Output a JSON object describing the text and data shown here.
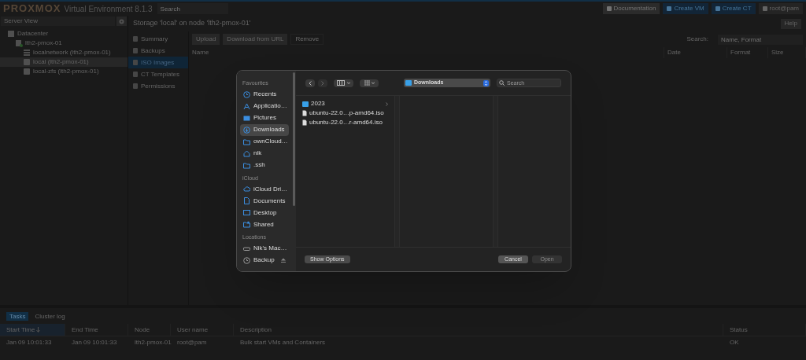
{
  "topbar": {
    "logo": "PROXMOX",
    "product": "Virtual Environment 8.1.3",
    "search_placeholder": "Search",
    "buttons": [
      {
        "label": "Documentation",
        "kind": "plain"
      },
      {
        "label": "Create VM",
        "kind": "primary"
      },
      {
        "label": "Create CT",
        "kind": "primary"
      },
      {
        "label": "root@pam",
        "kind": "user"
      }
    ]
  },
  "sidebar": {
    "view": "Server View",
    "tree": [
      {
        "label": "Datacenter",
        "kind": "datacenter",
        "selected": false,
        "children": [
          {
            "label": "lth2-pmox-01",
            "kind": "node",
            "selected": false,
            "children": [
              {
                "label": "localnetwork (lth2-pmox-01)",
                "kind": "network",
                "selected": false
              },
              {
                "label": "local (lth2-pmox-01)",
                "kind": "storage",
                "selected": true
              },
              {
                "label": "local-zfs (lth2-pmox-01)",
                "kind": "storage",
                "selected": false
              }
            ]
          }
        ]
      }
    ]
  },
  "content": {
    "title": "Storage 'local' on node 'lth2-pmox-01'",
    "help": "Help",
    "nav": [
      {
        "label": "Summary",
        "selected": false
      },
      {
        "label": "Backups",
        "selected": false
      },
      {
        "label": "ISO Images",
        "selected": true
      },
      {
        "label": "CT Templates",
        "selected": false
      },
      {
        "label": "Permissions",
        "selected": false
      }
    ],
    "toolbar": [
      {
        "label": "Upload",
        "disabled": false
      },
      {
        "label": "Download from URL",
        "disabled": false
      },
      {
        "label": "Remove",
        "disabled": true
      }
    ],
    "search_label": "Search:",
    "search_placeholder": "Name, Format",
    "columns": [
      "Name",
      "Date",
      "Format",
      "Size"
    ]
  },
  "tasks": {
    "tabs": [
      {
        "label": "Tasks",
        "selected": true
      },
      {
        "label": "Cluster log",
        "selected": false
      }
    ],
    "columns": [
      {
        "label": "Start Time",
        "sorted": true
      },
      {
        "label": "End Time",
        "sorted": false
      },
      {
        "label": "Node",
        "sorted": false
      },
      {
        "label": "User name",
        "sorted": false
      },
      {
        "label": "Description",
        "sorted": false
      },
      {
        "label": "Status",
        "sorted": false
      }
    ],
    "rows": [
      [
        "Jan 09 10:01:33",
        "Jan 09 10:01:33",
        "lth2-pmox-01",
        "root@pam",
        "Bulk start VMs and Containers",
        "OK"
      ]
    ]
  },
  "dialog": {
    "sections": [
      {
        "title": "Favourites",
        "items": [
          {
            "label": "Recents",
            "kind": "clock",
            "selected": false
          },
          {
            "label": "Applicatio…",
            "kind": "apps",
            "selected": false
          },
          {
            "label": "Pictures",
            "kind": "photo",
            "selected": false
          },
          {
            "label": "Downloads",
            "kind": "download",
            "selected": true
          },
          {
            "label": "ownCloud…",
            "kind": "folder",
            "selected": false
          },
          {
            "label": "nik",
            "kind": "home",
            "selected": false
          },
          {
            "label": ".ssh",
            "kind": "folder",
            "selected": false
          }
        ]
      },
      {
        "title": "iCloud",
        "items": [
          {
            "label": "iCloud Dri…",
            "kind": "cloud",
            "selected": false
          },
          {
            "label": "Documents",
            "kind": "doc",
            "selected": false
          },
          {
            "label": "Desktop",
            "kind": "desktop",
            "selected": false
          },
          {
            "label": "Shared",
            "kind": "shared",
            "selected": false
          }
        ]
      },
      {
        "title": "Locations",
        "items": [
          {
            "label": "Nik's Mac…",
            "kind": "drive",
            "selected": false
          },
          {
            "label": "Backup",
            "kind": "backup",
            "selected": false,
            "eject": true
          }
        ]
      }
    ],
    "location": "Downloads",
    "search_placeholder": "Search",
    "files": [
      {
        "name": "2023",
        "kind": "folder"
      },
      {
        "name": "ubuntu-22.0…p-amd64.iso",
        "kind": "file"
      },
      {
        "name": "ubuntu-22.0…r-amd64.iso",
        "kind": "file"
      }
    ],
    "options_button": "Show Options",
    "cancel_button": "Cancel",
    "open_button": "Open"
  }
}
